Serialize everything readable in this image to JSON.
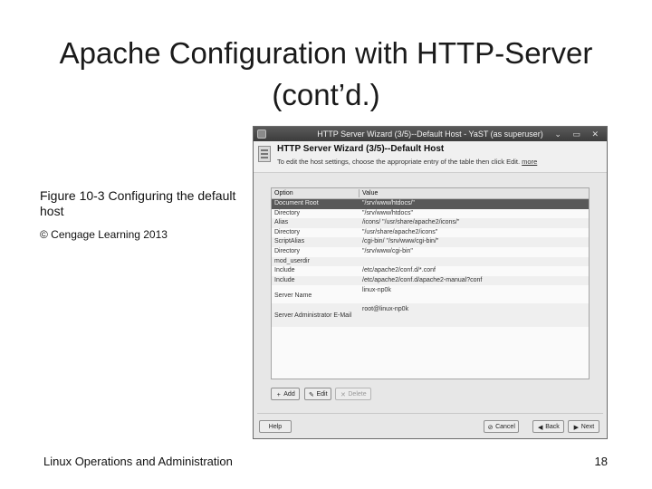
{
  "slide": {
    "title": "Apache Configuration with HTTP-Server (cont’d.)",
    "caption": "Figure 10-3 Configuring the default host",
    "copyright": "© Cengage Learning 2013",
    "footer": "Linux Operations and Administration",
    "page_number": "18"
  },
  "window": {
    "title": "HTTP Server Wizard (3/5)--Default Host - YaST (as superuser)",
    "controls": "⌄ ▭ ✕",
    "heading": "HTTP Server Wizard (3/5)--Default Host",
    "help_text": "To edit the host settings, choose the appropriate entry of the table then click Edit.",
    "more_link": "more",
    "columns": {
      "option": "Option",
      "value": "Value"
    },
    "rows": [
      {
        "option": "Document Root",
        "value": "\"/srv/www/htdocs/\""
      },
      {
        "option": "Directory",
        "value": "\"/srv/www/htdocs\""
      },
      {
        "option": "Alias",
        "value": "/icons/ \"/usr/share/apache2/icons/\""
      },
      {
        "option": "Directory",
        "value": "\"/usr/share/apache2/icons\""
      },
      {
        "option": "ScriptAlias",
        "value": "/cgi-bin/ \"/srv/www/cgi-bin/\""
      },
      {
        "option": "Directory",
        "value": "\"/srv/www/cgi-bin\""
      },
      {
        "option": "mod_userdir",
        "value": ""
      },
      {
        "option": "Include",
        "value": "/etc/apache2/conf.d/*.conf"
      },
      {
        "option": "Include",
        "value": "/etc/apache2/conf.d/apache2-manual?conf"
      },
      {
        "option": "Server Name",
        "value": "linux-np0k"
      },
      {
        "option": "Server Administrator E-Mail",
        "value": "root@linux-np0k"
      }
    ],
    "buttons": {
      "add": "Add",
      "edit": "Edit",
      "delete": "Delete",
      "help": "Help",
      "cancel": "Cancel",
      "back": "Back",
      "next": "Next"
    }
  }
}
